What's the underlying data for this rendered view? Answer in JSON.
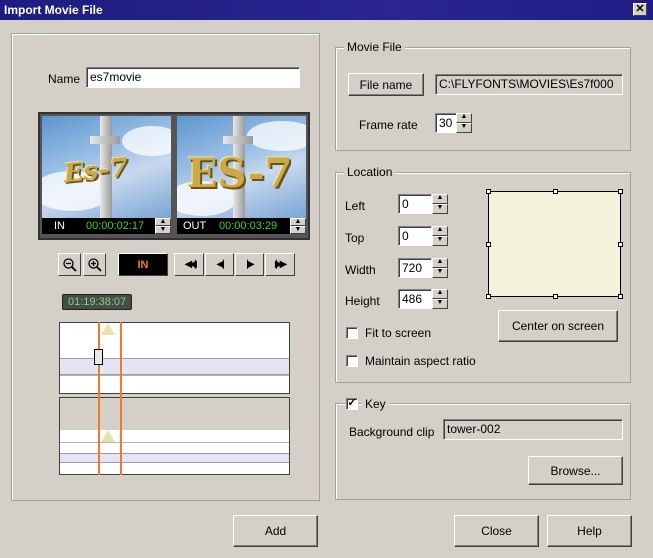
{
  "window": {
    "title": "Import Movie File",
    "close_glyph": "✕"
  },
  "name_field": {
    "label": "Name",
    "value": "es7movie"
  },
  "preview": {
    "in_label": "IN",
    "in_time": "00:00:02:17",
    "in_image_text": "Es-7",
    "out_label": "OUT",
    "out_time": "00:00:03:29",
    "out_image_text": "ES-7"
  },
  "transport": {
    "zoom_out_icon": "zoom-out-icon",
    "zoom_in_icon": "zoom-in-icon",
    "in_button": "IN",
    "rewind_start_glyph": "◀◀|",
    "step_back_glyph": "◀|",
    "step_forward_glyph": "|▶",
    "forward_end_glyph": "|▶▶"
  },
  "timeline": {
    "timecode": "01:19:38:07"
  },
  "movie_file": {
    "legend": "Movie File",
    "file_name_button": "File name",
    "path_value": "C:\\FLYFONTS\\MOVIES\\Es7f000",
    "frame_rate_label": "Frame rate",
    "frame_rate_value": "30"
  },
  "location": {
    "legend": "Location",
    "left_label": "Left",
    "left_value": "0",
    "top_label": "Top",
    "top_value": "0",
    "width_label": "Width",
    "width_value": "720",
    "height_label": "Height",
    "height_value": "486",
    "fit_label": "Fit to screen",
    "fit_checked": "",
    "aspect_label": "Maintain aspect ratio",
    "aspect_checked": "",
    "center_button": "Center on screen",
    "preview_color": "#f3f3dc"
  },
  "key": {
    "legend": "Key",
    "checked": "✓",
    "background_label": "Background clip",
    "background_value": "tower-002",
    "browse_button": "Browse..."
  },
  "footer": {
    "add_button": "Add",
    "close_button": "Close",
    "help_button": "Help"
  },
  "colors": {
    "titlebar": "#1d1c80",
    "timecode_green": "#3bd03b",
    "in_orange": "#ee7a2a",
    "face": "#d4d0c8"
  }
}
